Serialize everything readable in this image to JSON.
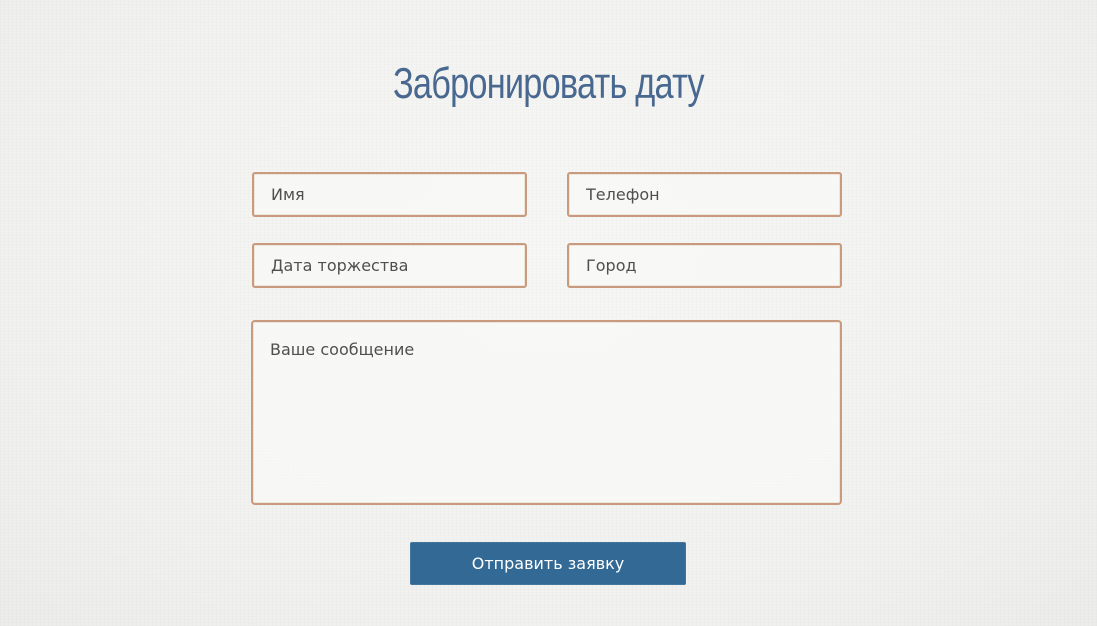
{
  "form": {
    "title": "Забронировать дату",
    "fields": {
      "name": {
        "placeholder": "Имя",
        "value": ""
      },
      "phone": {
        "placeholder": "Телефон",
        "value": ""
      },
      "event_date": {
        "placeholder": "Дата торжества",
        "value": ""
      },
      "city": {
        "placeholder": "Город",
        "value": ""
      },
      "message": {
        "placeholder": "Ваше сообщение",
        "value": ""
      }
    },
    "submit_label": "Отправить заявку"
  },
  "colors": {
    "background": "#f3f3f1",
    "title": "#48688f",
    "field_border": "#c89a7e",
    "field_text": "#4f4f4f",
    "button_bg": "#336a95",
    "button_text": "#ffffff"
  }
}
